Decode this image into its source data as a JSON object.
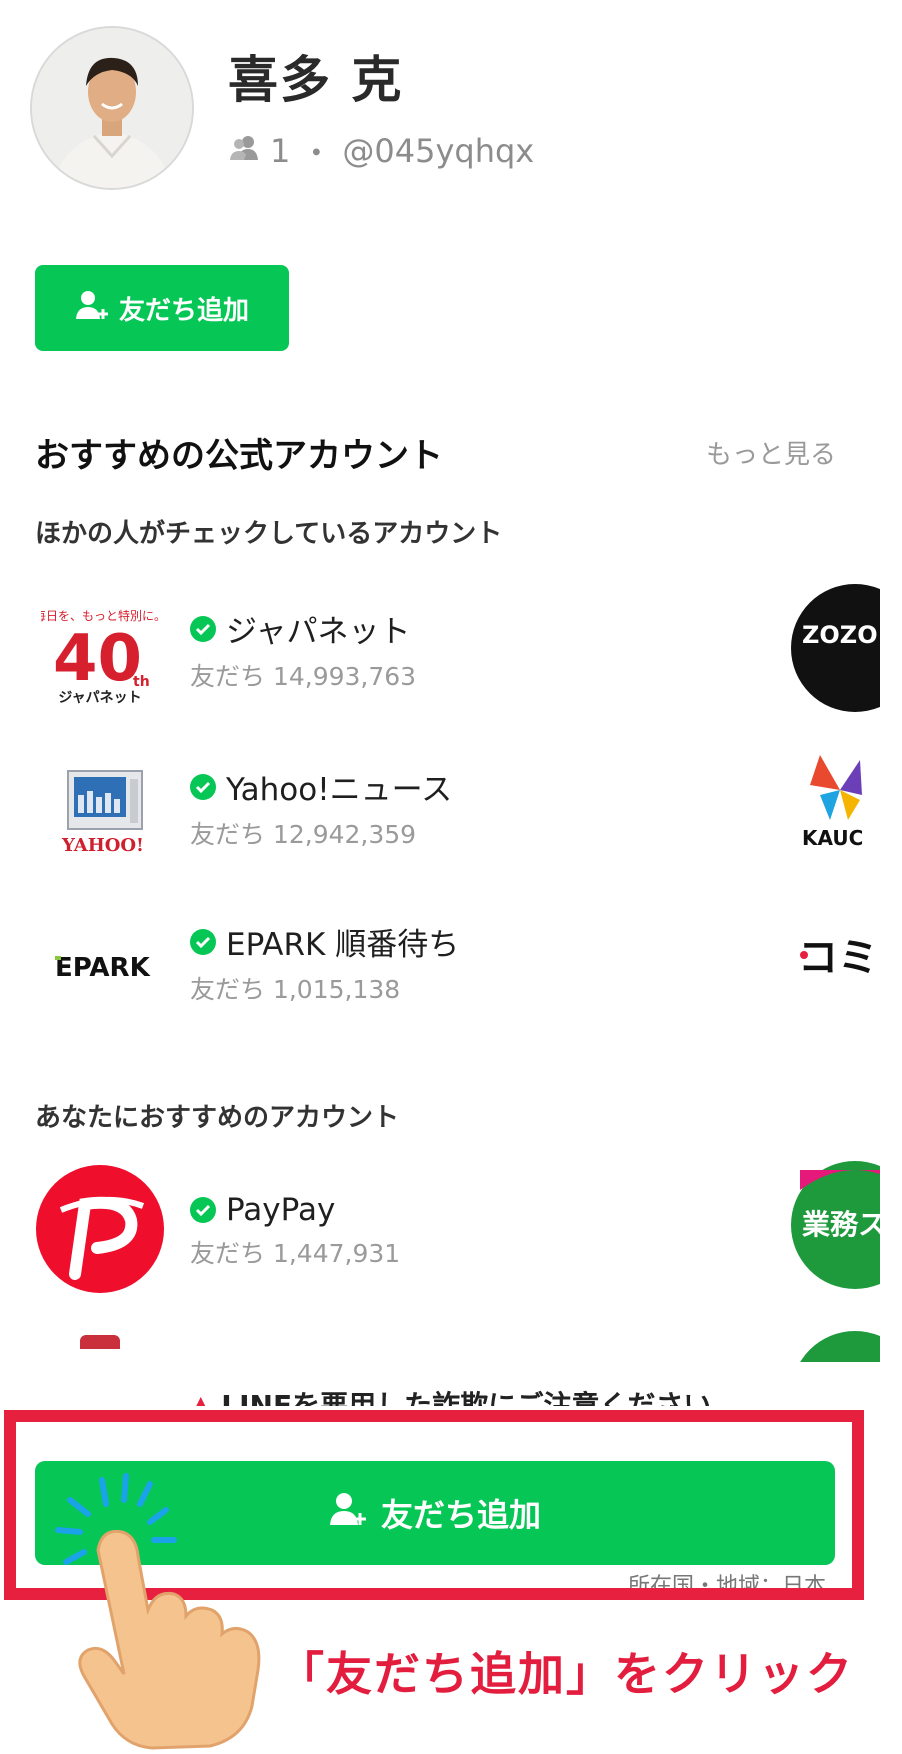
{
  "profile": {
    "name": "喜多 克",
    "friend_count": "1",
    "separator": "・",
    "line_id": "@045yqhqx"
  },
  "buttons": {
    "add_friend_small": "友だち追加",
    "add_friend_big": "友だち追加"
  },
  "recommended": {
    "title": "おすすめの公式アカウント",
    "more_link": "もっと見る",
    "others_checking_title": "ほかの人がチェックしているアカウント",
    "others_checking": [
      {
        "name": "ジャパネット",
        "friends": "友だち 14,993,763",
        "logo_text": "40"
      },
      {
        "name": "Yahoo!ニュース",
        "friends": "友だち 12,942,359",
        "logo_text": "YAHOO!"
      },
      {
        "name": "EPARK 順番待ち",
        "friends": "友だち 1,015,138",
        "logo_text": "EPARK"
      }
    ],
    "for_you_title": "あなたにおすすめのアカウント",
    "for_you": [
      {
        "name": "PayPay",
        "friends": "友だち 1,447,931"
      }
    ],
    "side_thumbs": [
      "ZOZO TOWN",
      "KAUC",
      "コミ",
      "業務スーパー"
    ]
  },
  "warning": "LINEを悪用した詐欺にご注意ください",
  "region": "所在国・地域：日本",
  "annotation": {
    "callout": "「友だち追加」をクリック"
  },
  "colors": {
    "line_green": "#06c755",
    "highlight_red": "#e8203f"
  }
}
